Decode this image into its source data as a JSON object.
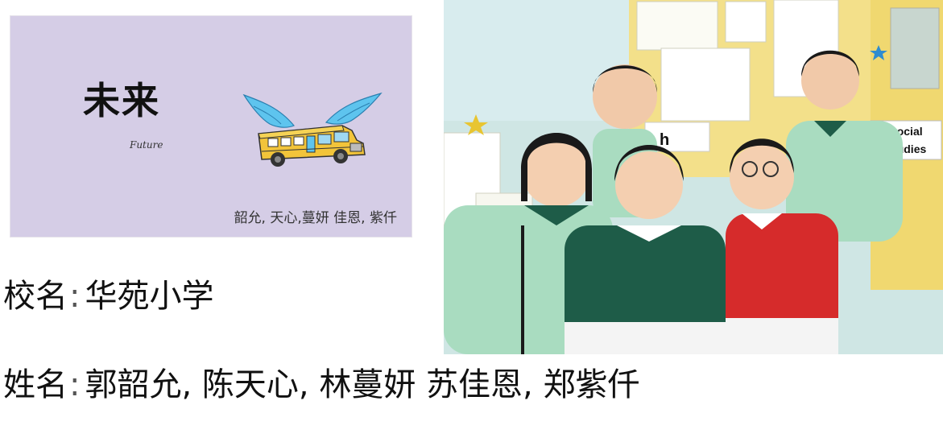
{
  "banner": {
    "title": "未来",
    "subtitle": "Future",
    "members": "韶允, 天心,蔓妍 佳恩, 紫仟",
    "background_color": "#d5cde6"
  },
  "photo": {
    "board_labels": {
      "social_studies_1": "Social",
      "social_studies_2": "Studies",
      "partial_word": "h"
    }
  },
  "info": {
    "school_label": "校名",
    "school_sep": ":",
    "school_value": "华苑小学",
    "names_label": "姓名",
    "names_sep": ":",
    "names_value": "郭韶允,  陈天心, 林蔓妍 苏佳恩, 郑紫仟"
  }
}
